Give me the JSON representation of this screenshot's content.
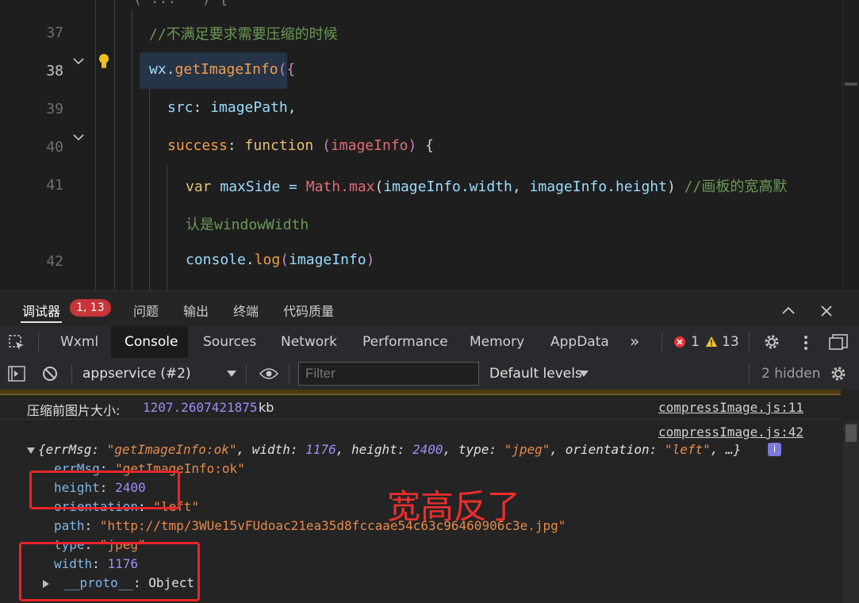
{
  "editor": {
    "line_numbers": [
      "37",
      "38",
      "39",
      "40",
      "41",
      "42"
    ],
    "comment_line": "//不满足要求需要压缩的时候",
    "l38": {
      "obj": "wx",
      "dot": ".",
      "fn": "getImageInfo",
      "open": "({"
    },
    "l39": {
      "key": "src",
      "colon": ": ",
      "val": "imagePath",
      "comma": ","
    },
    "l40": {
      "key": "success",
      "colon": ": ",
      "kw": "function",
      "param_open": " (",
      "param": "imageInfo",
      "param_close": ")",
      "brace": " {"
    },
    "l41": {
      "kw": "var",
      "name": " maxSide",
      "eq": " = ",
      "cls": "Math",
      "dot": ".",
      "fn": "max",
      "args_open": "(",
      "a1": "imageInfo",
      "a1p": ".width",
      "sep": ", ",
      "a2": "imageInfo",
      "a2p": ".height",
      "close": ")",
      "comment": " //画板的宽高默"
    },
    "l41_wrap": "认是windowWidth",
    "l42": {
      "obj": "console",
      "dot": ".",
      "fn": "log",
      "open": "(",
      "arg": "imageInfo",
      "close": ")"
    },
    "lightbulb_icon": "lightbulb-icon"
  },
  "panel_tabs": {
    "debugger": "调试器",
    "badge": "1, 13",
    "problems": "问题",
    "output": "输出",
    "terminal": "终端",
    "quality": "代码质量"
  },
  "devtools_tabs": [
    "Wxml",
    "Console",
    "Sources",
    "Network",
    "Performance",
    "Memory",
    "AppData"
  ],
  "devtools_counts": {
    "errors": "1",
    "warnings": "13"
  },
  "filter_bar": {
    "context": "appservice (#2)",
    "filter_placeholder": "Filter",
    "levels": "Default levels",
    "hidden": "2 hidden"
  },
  "console": {
    "row1_label": "压缩前图片大小: ",
    "row1_value": "1207.2607421875",
    "row1_unit": " kb",
    "row1_source": "compressImage.js:11",
    "row2_source": "compressImage.js:42",
    "summary": {
      "open": "{",
      "errMsg_key": "errMsg",
      "errMsg_val": "\"getImageInfo:ok\"",
      "width_key": "width",
      "width_val": "1176",
      "height_key": "height",
      "height_val": "2400",
      "type_key": "type",
      "type_val": "\"jpeg\"",
      "orientation_key": "orientation",
      "orientation_val": "\"left\"",
      "rest": ", …}"
    },
    "props": [
      {
        "key": "errMsg",
        "val": "\"getImageInfo:ok\""
      },
      {
        "key": "height",
        "val": "2400"
      },
      {
        "key": "orientation",
        "val": "\"left\""
      },
      {
        "key": "path",
        "val": "\"http://tmp/3WUe15vFUdoac21ea35d8fccaae54c63c96460906c3e.jpg\""
      },
      {
        "key": "type",
        "val": "\"jpeg\""
      },
      {
        "key": "width",
        "val": "1176"
      },
      {
        "key": "__proto__",
        "val": "Object"
      }
    ]
  },
  "annotation": "宽高反了",
  "colors": {
    "annotation_red": "#ee2d2d",
    "badge_red": "#c7353a"
  }
}
